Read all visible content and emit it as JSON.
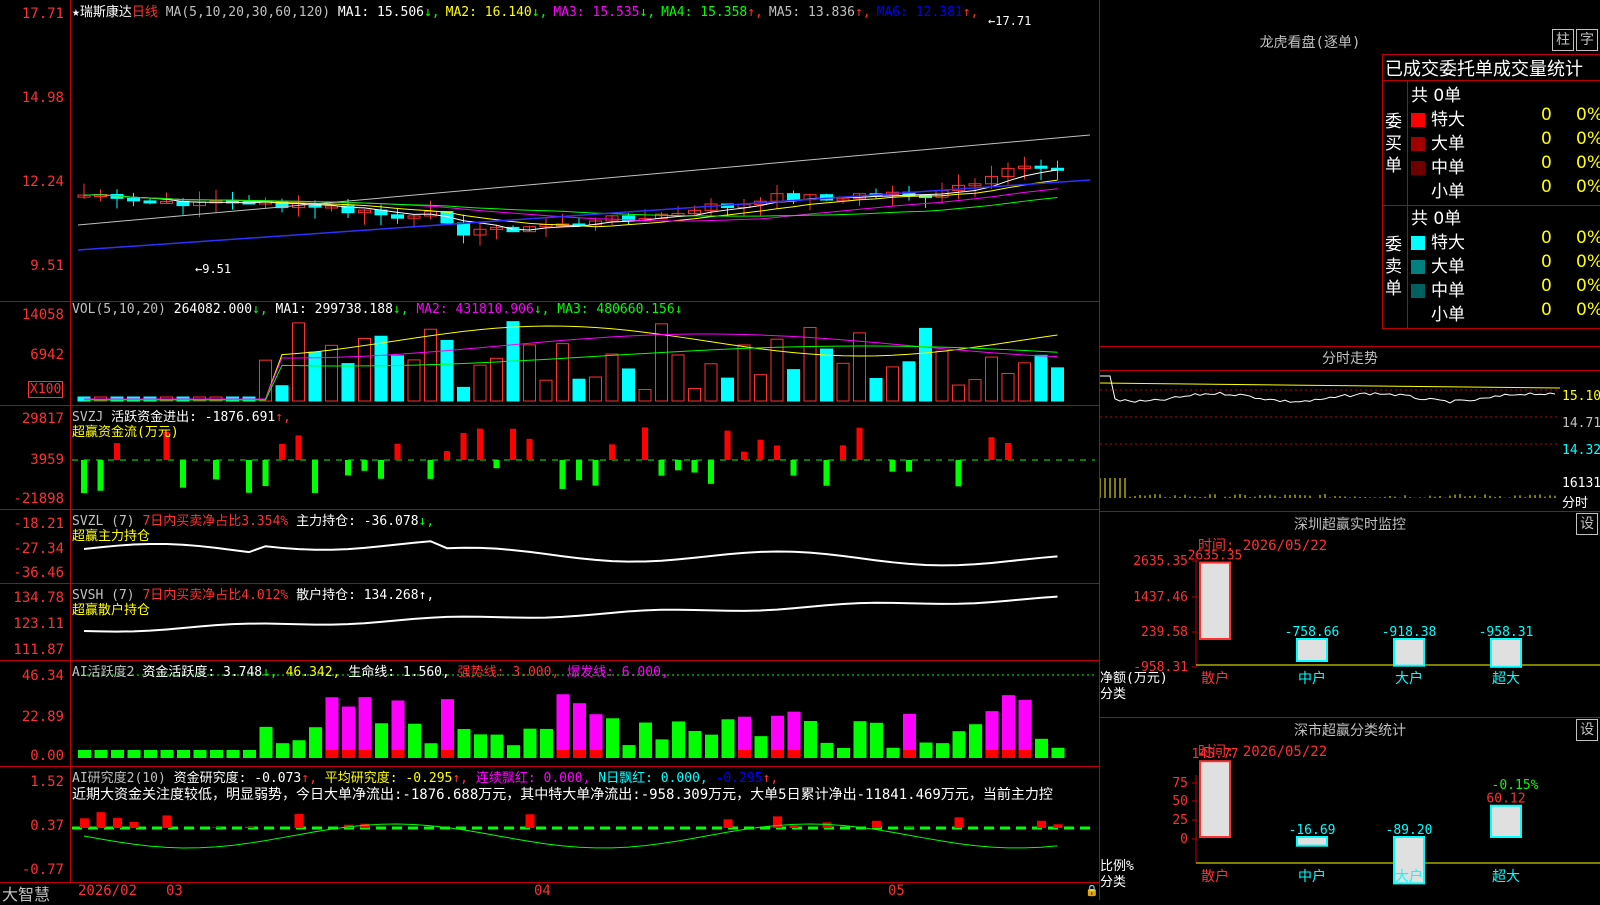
{
  "stock": {
    "name": "瑞斯康达",
    "period": "日线"
  },
  "price_panel": {
    "ma_label": "MA(5,10,20,30,60,120)",
    "ma_values": [
      {
        "label": "MA1:",
        "value": "15.506",
        "arrow": "↓",
        "color": "#ffffff"
      },
      {
        "label": "MA2:",
        "value": "16.140",
        "arrow": "↓",
        "color": "#ffff00"
      },
      {
        "label": "MA3:",
        "value": "15.535",
        "arrow": "↓",
        "color": "#ff00ff"
      },
      {
        "label": "MA4:",
        "value": "15.358",
        "arrow": "↑",
        "color": "#00ff00"
      },
      {
        "label": "MA5:",
        "value": "13.836",
        "arrow": "↑",
        "color": "#c0c0c0"
      },
      {
        "label": "MA6:",
        "value": "12.381",
        "arrow": "↑",
        "color": "#0000ff"
      }
    ],
    "y_ticks": [
      "17.71",
      "14.98",
      "12.24",
      "9.51"
    ],
    "high_note": "←17.71",
    "low_note": "←9.51"
  },
  "vol_panel": {
    "label": "VOL(5,10,20)",
    "value": "264082.000",
    "ma1": "MA1: 299738.188",
    "ma2": "MA2: 431810.906",
    "ma3": "MA3: 480660.156",
    "y_ticks": [
      "14058",
      "6942"
    ],
    "unit": "X100"
  },
  "svzj_panel": {
    "label": "SVZJ",
    "desc": "活跃资金进出: -1876.691",
    "arrow": "↑,",
    "sub": "超赢资金流(万元)",
    "y_ticks": [
      "29817",
      "3959",
      "-21898"
    ]
  },
  "svzl_panel": {
    "label": "SVZL (7)",
    "desc": "7日内买卖净占比3.354%",
    "desc2": "主力持仓: -36.078",
    "arrow": "↓,",
    "sub": "超赢主力持仓",
    "y_ticks": [
      "-18.21",
      "-27.34",
      "-36.46"
    ]
  },
  "svsh_panel": {
    "label": "SVSH (7)",
    "desc": "7日内买卖净占比4.012%",
    "desc2": "散户持仓: 134.268",
    "arrow": "↑,",
    "sub": "超赢散户持仓",
    "y_ticks": [
      "134.78",
      "123.11",
      "111.87"
    ]
  },
  "ai_active": {
    "label": "AI活跃度2",
    "a": "资金活跃度: 3.748",
    "a_arrow": "↓,",
    "b": "46.342,",
    "c": "生命线: 1.560,",
    "d": "强势线: 3.000,",
    "e": "爆发线: 6.000,",
    "y_ticks": [
      "46.34",
      "22.89",
      "0.00"
    ]
  },
  "ai_research": {
    "label": "AI研究度2(10)",
    "a": "资金研究度: -0.073",
    "a_arrow": "↑,",
    "b": "平均研究度: -0.295",
    "b_arrow": "↑,",
    "c": "连续飘红: 0.000,",
    "d": "N日飘红: 0.000,",
    "e": "-0.295",
    "e_arrow": "↑,",
    "text": "近期大资金关注度较低，明显弱势，今日大单净流出:-1876.688万元，其中特大单净流出:-958.309万元，大单5日累计净出-11841.469万元，当前主力控",
    "y_ticks": [
      "1.52",
      "0.37",
      "-0.77"
    ]
  },
  "bottom": {
    "brand": "大智慧",
    "dates": [
      "2026/02",
      "03",
      "04",
      "05"
    ]
  },
  "longhu": {
    "title": "龙虎看盘(逐单)",
    "btn1": "柱",
    "btn2": "字",
    "tabs_text": "已成交委托单成交量统计",
    "buy": {
      "side": "委买单",
      "count": "共 0单",
      "rows": [
        {
          "name": "特大",
          "v": "0",
          "p": "0%",
          "color": "#ff0000"
        },
        {
          "name": "大单",
          "v": "0",
          "p": "0%",
          "color": "#a00000"
        },
        {
          "name": "中单",
          "v": "0",
          "p": "0%",
          "color": "#700000"
        },
        {
          "name": "小单",
          "v": "0",
          "p": "0%",
          "color": "#000000"
        }
      ]
    },
    "sell": {
      "side": "委卖单",
      "count": "共 0单",
      "rows": [
        {
          "name": "特大",
          "v": "0",
          "p": "0%",
          "color": "#00ffff"
        },
        {
          "name": "大单",
          "v": "0",
          "p": "0%",
          "color": "#008080"
        },
        {
          "name": "中单",
          "v": "0",
          "p": "0%",
          "color": "#006060"
        },
        {
          "name": "小单",
          "v": "0",
          "p": "0%",
          "color": "#000000"
        }
      ]
    }
  },
  "fenshi": {
    "title": "分时走势",
    "y_ticks": [
      "15.10",
      "14.71",
      "14.32",
      "16131"
    ],
    "unit": "分时"
  },
  "sz_monitor": {
    "title": "深圳超赢实时监控",
    "btn": "设",
    "date": "时间: 2026/05/22",
    "y_ticks": [
      "2635.35",
      "1437.46",
      "239.58",
      "-958.31"
    ],
    "ylabel": "净额(万元)",
    "xlabel": "分类",
    "cats": [
      "散户",
      "中户",
      "大户",
      "超大"
    ],
    "values": [
      2635.35,
      -758.66,
      -918.38,
      -958.31
    ],
    "value_labels": [
      "2635.35",
      "-758.66",
      "-918.38",
      "-958.31"
    ]
  },
  "sz_classify": {
    "title": "深市超赢分类统计",
    "btn": "设",
    "date": "时间: 2026/05/22",
    "y_ticks": [
      "75",
      "50",
      "25",
      "0"
    ],
    "ylabel": "比例%",
    "xlabel": "分类",
    "cats": [
      "散户",
      "中户",
      "大户",
      "超大"
    ],
    "values": [
      145.77,
      -16.69,
      -89.2,
      60.12
    ],
    "value_labels": [
      "145.77",
      "-16.69",
      "-89.20",
      "60.12"
    ],
    "top_label": "-0.15%"
  }
}
